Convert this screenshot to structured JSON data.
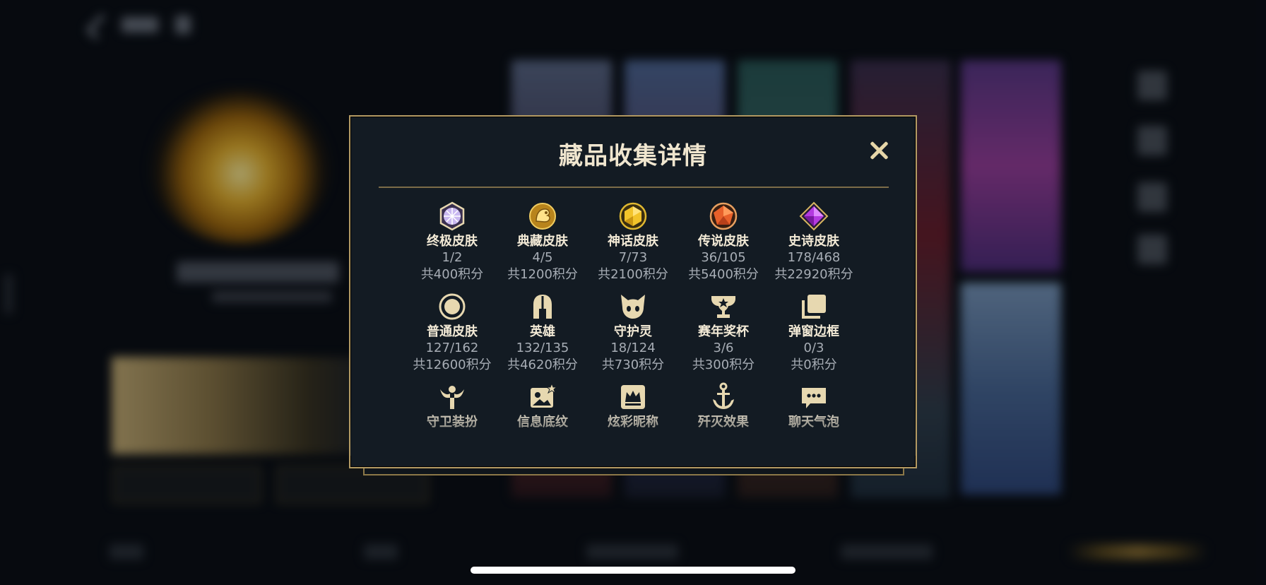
{
  "modal": {
    "title": "藏品收集详情",
    "close_icon": "close-icon"
  },
  "rows": [
    [
      {
        "icon": "ultimate-skin-icon",
        "name": "终极皮肤",
        "count": "1/2",
        "points": "共400积分"
      },
      {
        "icon": "collection-skin-icon",
        "name": "典藏皮肤",
        "count": "4/5",
        "points": "共1200积分"
      },
      {
        "icon": "mythic-skin-icon",
        "name": "神话皮肤",
        "count": "7/73",
        "points": "共2100积分"
      },
      {
        "icon": "legendary-skin-icon",
        "name": "传说皮肤",
        "count": "36/105",
        "points": "共5400积分"
      },
      {
        "icon": "epic-skin-icon",
        "name": "史诗皮肤",
        "count": "178/468",
        "points": "共22920积分"
      }
    ],
    [
      {
        "icon": "normal-skin-icon",
        "name": "普通皮肤",
        "count": "127/162",
        "points": "共12600积分"
      },
      {
        "icon": "hero-helmet-icon",
        "name": "英雄",
        "count": "132/135",
        "points": "共4620积分"
      },
      {
        "icon": "guardian-spirit-icon",
        "name": "守护灵",
        "count": "18/124",
        "points": "共730积分"
      },
      {
        "icon": "season-trophy-icon",
        "name": "赛年奖杯",
        "count": "3/6",
        "points": "共300积分"
      },
      {
        "icon": "popup-frame-icon",
        "name": "弹窗边框",
        "count": "0/3",
        "points": "共0积分"
      }
    ],
    [
      {
        "icon": "guardian-outfit-icon",
        "name": "守卫装扮",
        "count": "",
        "points": ""
      },
      {
        "icon": "info-pattern-icon",
        "name": "信息底纹",
        "count": "",
        "points": ""
      },
      {
        "icon": "colorful-nickname-icon",
        "name": "炫彩昵称",
        "count": "",
        "points": ""
      },
      {
        "icon": "kill-effect-icon",
        "name": "歼灭效果",
        "count": "",
        "points": ""
      },
      {
        "icon": "chat-bubble-icon",
        "name": "聊天气泡",
        "count": "",
        "points": ""
      }
    ]
  ],
  "colors": {
    "accent_gold": "#b39a63",
    "title_text": "#f0e6cf",
    "sub_text": "#a7adb5",
    "icon_gold": "#e7d8b0"
  }
}
